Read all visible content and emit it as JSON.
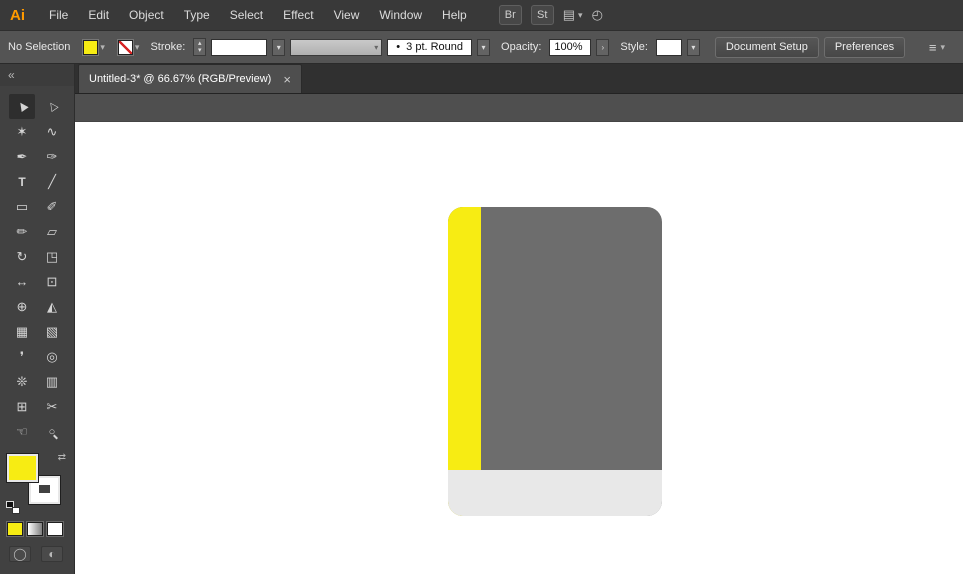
{
  "app": {
    "logo": "Ai"
  },
  "colors": {
    "logo_orange": "#ff9a00",
    "accent_yellow": "#f7ec13",
    "none_red": "#d62424",
    "book_cover_gray": "#6d6d6d",
    "book_pages_gray": "#e8e8e8",
    "artboard_white": "#ffffff"
  },
  "ui": {
    "chevron_down": "▾",
    "chevron_right": "›",
    "stepper_up": "▴",
    "stepper_down": "▾",
    "swap": "⇄",
    "collapse": "«",
    "brush_dot": "•",
    "menu_lines": "≡",
    "arrange_icon": "▤",
    "gauge_icon": "◴",
    "draw_mode": "◯",
    "screen_mode": "◐"
  },
  "menubar": {
    "items": [
      "File",
      "Edit",
      "Object",
      "Type",
      "Select",
      "Effect",
      "View",
      "Window",
      "Help"
    ],
    "bridge_label": "Br",
    "stock_label": "St"
  },
  "controlbar": {
    "selection_status": "No Selection",
    "stroke_label": "Stroke:",
    "brush_value": "3 pt. Round",
    "opacity_label": "Opacity:",
    "opacity_value": "100%",
    "style_label": "Style:",
    "document_setup_label": "Document Setup",
    "preferences_label": "Preferences"
  },
  "tabbar": {
    "active_tab_title": "Untitled-3* @ 66.67% (RGB/Preview)",
    "close_glyph": "×"
  },
  "toolbar": {
    "tools": [
      {
        "name": "selection",
        "glyph": "▶"
      },
      {
        "name": "direct-selection",
        "glyph": "▷"
      },
      {
        "name": "magic-wand",
        "glyph": "✶"
      },
      {
        "name": "lasso",
        "glyph": "∿"
      },
      {
        "name": "pen",
        "glyph": "✒"
      },
      {
        "name": "curvature",
        "glyph": "✑"
      },
      {
        "name": "type",
        "glyph": "T"
      },
      {
        "name": "line-segment",
        "glyph": "╱"
      },
      {
        "name": "rectangle",
        "glyph": "▭"
      },
      {
        "name": "paintbrush",
        "glyph": "✐"
      },
      {
        "name": "pencil",
        "glyph": "✏"
      },
      {
        "name": "eraser",
        "glyph": "▱"
      },
      {
        "name": "rotate",
        "glyph": "↻"
      },
      {
        "name": "scale",
        "glyph": "◳"
      },
      {
        "name": "width",
        "glyph": "↔"
      },
      {
        "name": "free-transform",
        "glyph": "⊡"
      },
      {
        "name": "shape-builder",
        "glyph": "⊕"
      },
      {
        "name": "perspective-grid",
        "glyph": "◭"
      },
      {
        "name": "mesh",
        "glyph": "▦"
      },
      {
        "name": "gradient",
        "glyph": "▧"
      },
      {
        "name": "eyedropper",
        "glyph": "❜"
      },
      {
        "name": "blend",
        "glyph": "◎"
      },
      {
        "name": "symbol-sprayer",
        "glyph": "❊"
      },
      {
        "name": "column-graph",
        "glyph": "▥"
      },
      {
        "name": "artboard",
        "glyph": "⊞"
      },
      {
        "name": "slice",
        "glyph": "✂"
      },
      {
        "name": "hand",
        "glyph": "☜"
      },
      {
        "name": "zoom",
        "glyph": "○"
      }
    ]
  }
}
